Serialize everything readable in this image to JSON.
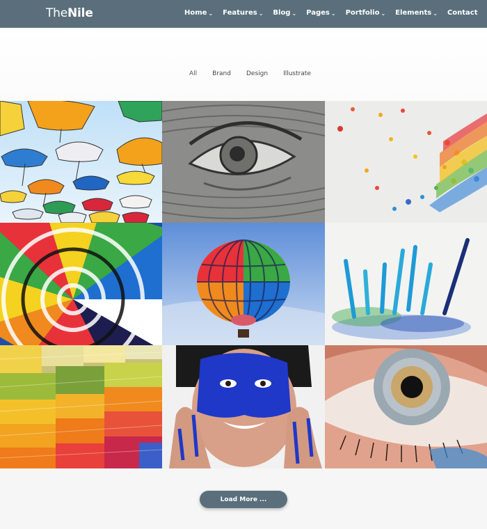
{
  "brand": {
    "logo_light": "The",
    "logo_bold": "Nile"
  },
  "nav": {
    "items": [
      {
        "label": "Home",
        "has_dropdown": true
      },
      {
        "label": "Features",
        "has_dropdown": true
      },
      {
        "label": "Blog",
        "has_dropdown": true
      },
      {
        "label": "Pages",
        "has_dropdown": true
      },
      {
        "label": "Portfolio",
        "has_dropdown": true
      },
      {
        "label": "Elements",
        "has_dropdown": true
      },
      {
        "label": "Contact",
        "has_dropdown": false
      }
    ]
  },
  "filters": [
    {
      "label": "All",
      "active": true
    },
    {
      "label": "Brand",
      "active": false
    },
    {
      "label": "Design",
      "active": false
    },
    {
      "label": "Illustrate",
      "active": false
    }
  ],
  "gallery": {
    "images": [
      {
        "subject": "umbrellas"
      },
      {
        "subject": "banknote-eye"
      },
      {
        "subject": "confetti"
      },
      {
        "subject": "balloon-canopy"
      },
      {
        "subject": "hot-air-balloon"
      },
      {
        "subject": "pencils"
      },
      {
        "subject": "stacked-paper"
      },
      {
        "subject": "blue-painted-face"
      },
      {
        "subject": "eye-closeup"
      }
    ]
  },
  "load_more": {
    "label": "Load More ..."
  },
  "colors": {
    "header": "#5a6f7b",
    "button": "#5a6f7b",
    "background": "#f6f6f6"
  }
}
